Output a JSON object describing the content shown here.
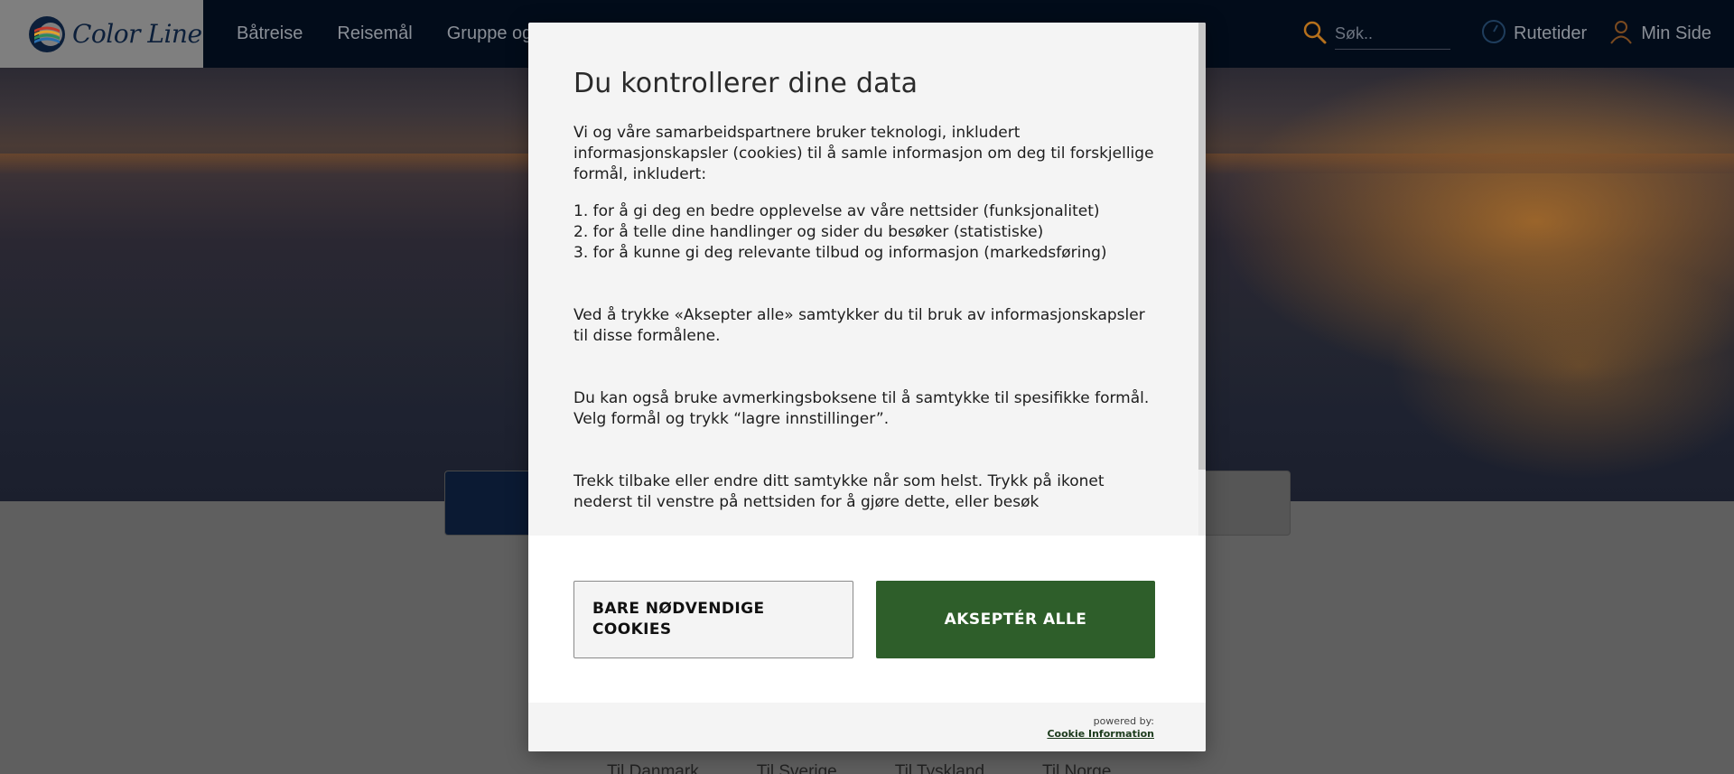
{
  "header": {
    "brand": "Color Line",
    "nav_items": [
      "Båtreise",
      "Reisemål",
      "Gruppe og"
    ],
    "search_placeholder": "Søk..",
    "timetable_label": "Rutetider",
    "my_page_label": "Min Side"
  },
  "destinations": [
    "Til Danmark",
    "Til Sverige",
    "Til Tyskland",
    "Til Norge"
  ],
  "consent": {
    "title": "Du kontrollerer dine data",
    "intro": "Vi og våre samarbeidspartnere bruker teknologi, inkludert informasjonskapsler (cookies) til å samle informasjon om deg til forskjellige formål, inkludert:",
    "purposes": [
      "1. for å gi deg en bedre opplevelse av våre nettsider (funksjonalitet)",
      "2. for å telle dine handlinger og sider du besøker (statistiske)",
      "3. for å kunne gi deg relevante tilbud og informasjon (markedsføring)"
    ],
    "accept_info": "Ved å trykke «Aksepter alle» samtykker du til bruk av informasjonskapsler til disse formålene.",
    "checkbox_info": "Du kan også bruke avmerkingsboksene til å samtykke til spesifikke formål. Velg formål og trykk “lagre innstillinger”.",
    "withdraw_info": "Trekk tilbake eller endre ditt samtykke når som helst. Trykk på ikonet nederst til venstre på nettsiden for å gjøre dette, eller besøk",
    "btn_necessary": "BARE NØDVENDIGE COOKIES",
    "btn_accept": "AKSEPTÉR ALLE",
    "powered_by": "powered by:",
    "powered_link": "Cookie Information"
  },
  "colors": {
    "accept_green": "#2e5e2a",
    "header_bg": "#020c1a",
    "icon_orange": "#c47a1e"
  }
}
